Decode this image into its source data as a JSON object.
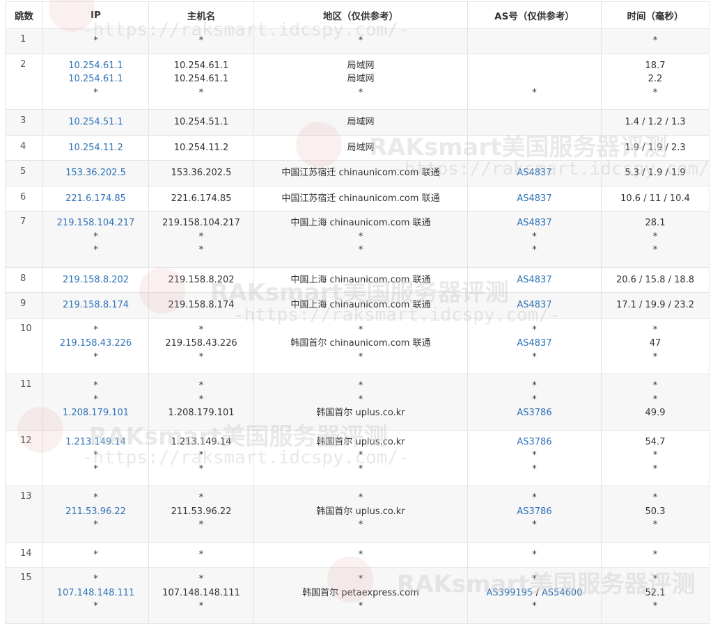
{
  "table": {
    "headers": [
      "跳数",
      "IP",
      "主机名",
      "地区（仅供参考）",
      "AS号（仅供参考）",
      "时间（毫秒）"
    ],
    "rows": [
      {
        "hop": "1",
        "lines": 1,
        "ip": [
          {
            "t": "*",
            "at": 0
          }
        ],
        "host": [
          {
            "t": "*",
            "at": 0
          }
        ],
        "region": [
          {
            "t": "*",
            "at": 0
          }
        ],
        "as": [
          [
            {
              "t": "*",
              "at": 0
            }
          ]
        ],
        "time": [
          {
            "t": "*",
            "at": 0
          }
        ]
      },
      {
        "hop": "2",
        "lines": 3,
        "ip": [
          {
            "t": "10.254.61.1",
            "at": 0,
            "link": true
          },
          {
            "t": "10.254.61.1",
            "at": 1,
            "link": true
          },
          {
            "t": "*",
            "at": 2
          }
        ],
        "host": [
          {
            "t": "10.254.61.1",
            "at": 0
          },
          {
            "t": "10.254.61.1",
            "at": 1
          },
          {
            "t": "*",
            "at": 2
          }
        ],
        "region": [
          {
            "t": "局域网",
            "at": 0
          },
          {
            "t": "局域网",
            "at": 1
          },
          {
            "t": "*",
            "at": 2
          }
        ],
        "as": [
          {
            "at": 2,
            "parts": [
              {
                "t": "*"
              }
            ]
          }
        ],
        "time": [
          {
            "t": "18.7",
            "at": 0
          },
          {
            "t": "2.2",
            "at": 1
          },
          {
            "t": "*",
            "at": 2
          }
        ]
      },
      {
        "hop": "3",
        "lines": 1,
        "ip": [
          {
            "t": "10.254.51.1",
            "at": 0,
            "link": true
          }
        ],
        "host": [
          {
            "t": "10.254.51.1",
            "at": 0
          }
        ],
        "region": [
          {
            "t": "局域网",
            "at": 0
          }
        ],
        "as": [],
        "time": [
          {
            "t": "1.4 / 1.2 / 1.3",
            "at": 0
          }
        ]
      },
      {
        "hop": "4",
        "lines": 1,
        "ip": [
          {
            "t": "10.254.11.2",
            "at": 0,
            "link": true
          }
        ],
        "host": [
          {
            "t": "10.254.11.2",
            "at": 0
          }
        ],
        "region": [
          {
            "t": "局域网",
            "at": 0
          }
        ],
        "as": [],
        "time": [
          {
            "t": "1.9 / 1.9 / 2.3",
            "at": 0
          }
        ]
      },
      {
        "hop": "5",
        "lines": 1,
        "ip": [
          {
            "t": "153.36.202.5",
            "at": 0,
            "link": true
          }
        ],
        "host": [
          {
            "t": "153.36.202.5",
            "at": 0
          }
        ],
        "region": [
          {
            "t": "中国江苏宿迁 chinaunicom.com 联通",
            "at": 0
          }
        ],
        "as": [
          {
            "at": 0,
            "parts": [
              {
                "t": "AS4837",
                "link": true
              }
            ]
          }
        ],
        "time": [
          {
            "t": "5.3 / 1.9 / 1.9",
            "at": 0
          }
        ]
      },
      {
        "hop": "6",
        "lines": 1,
        "ip": [
          {
            "t": "221.6.174.85",
            "at": 0,
            "link": true
          }
        ],
        "host": [
          {
            "t": "221.6.174.85",
            "at": 0
          }
        ],
        "region": [
          {
            "t": "中国江苏宿迁 chinaunicom.com 联通",
            "at": 0
          }
        ],
        "as": [
          {
            "at": 0,
            "parts": [
              {
                "t": "AS4837",
                "link": true
              }
            ]
          }
        ],
        "time": [
          {
            "t": "10.6 / 11 / 10.4",
            "at": 0
          }
        ]
      },
      {
        "hop": "7",
        "lines": 3,
        "ip": [
          {
            "t": "219.158.104.217",
            "at": 0,
            "link": true
          },
          {
            "t": "*",
            "at": 1
          },
          {
            "t": "*",
            "at": 2
          }
        ],
        "host": [
          {
            "t": "219.158.104.217",
            "at": 0
          },
          {
            "t": "*",
            "at": 1
          },
          {
            "t": "*",
            "at": 2
          }
        ],
        "region": [
          {
            "t": "中国上海 chinaunicom.com 联通",
            "at": 0
          },
          {
            "t": "*",
            "at": 1
          },
          {
            "t": "*",
            "at": 2
          }
        ],
        "as": [
          {
            "at": 0,
            "parts": [
              {
                "t": "AS4837",
                "link": true
              }
            ]
          },
          {
            "at": 1,
            "parts": [
              {
                "t": "*"
              }
            ]
          },
          {
            "at": 2,
            "parts": [
              {
                "t": "*"
              }
            ]
          }
        ],
        "time": [
          {
            "t": "28.1",
            "at": 0
          },
          {
            "t": "*",
            "at": 1
          },
          {
            "t": "*",
            "at": 2
          }
        ]
      },
      {
        "hop": "8",
        "lines": 1,
        "ip": [
          {
            "t": "219.158.8.202",
            "at": 0,
            "link": true
          }
        ],
        "host": [
          {
            "t": "219.158.8.202",
            "at": 0
          }
        ],
        "region": [
          {
            "t": "中国上海 chinaunicom.com 联通",
            "at": 0
          }
        ],
        "as": [
          {
            "at": 0,
            "parts": [
              {
                "t": "AS4837",
                "link": true
              }
            ]
          }
        ],
        "time": [
          {
            "t": "20.6 / 15.8 / 18.8",
            "at": 0
          }
        ]
      },
      {
        "hop": "9",
        "lines": 1,
        "ip": [
          {
            "t": "219.158.8.174",
            "at": 0,
            "link": true
          }
        ],
        "host": [
          {
            "t": "219.158.8.174",
            "at": 0
          }
        ],
        "region": [
          {
            "t": "中国上海 chinaunicom.com 联通",
            "at": 0
          }
        ],
        "as": [
          {
            "at": 0,
            "parts": [
              {
                "t": "AS4837",
                "link": true
              }
            ]
          }
        ],
        "time": [
          {
            "t": "17.1 / 19.9 / 23.2",
            "at": 0
          }
        ]
      },
      {
        "hop": "10",
        "lines": 3,
        "ip": [
          {
            "t": "*",
            "at": 0
          },
          {
            "t": "219.158.43.226",
            "at": 1,
            "link": true
          },
          {
            "t": "*",
            "at": 2
          }
        ],
        "host": [
          {
            "t": "*",
            "at": 0
          },
          {
            "t": "219.158.43.226",
            "at": 1
          },
          {
            "t": "*",
            "at": 2
          }
        ],
        "region": [
          {
            "t": "*",
            "at": 0
          },
          {
            "t": "韩国首尔 chinaunicom.com 联通",
            "at": 1
          },
          {
            "t": "*",
            "at": 2
          }
        ],
        "as": [
          {
            "at": 0,
            "parts": [
              {
                "t": "*"
              }
            ]
          },
          {
            "at": 1,
            "parts": [
              {
                "t": "AS4837",
                "link": true
              }
            ]
          },
          {
            "at": 2,
            "parts": [
              {
                "t": "*"
              }
            ]
          }
        ],
        "time": [
          {
            "t": "*",
            "at": 0
          },
          {
            "t": "47",
            "at": 1
          },
          {
            "t": "*",
            "at": 2
          }
        ]
      },
      {
        "hop": "11",
        "lines": 3,
        "ip": [
          {
            "t": "*",
            "at": 0
          },
          {
            "t": "*",
            "at": 1
          },
          {
            "t": "1.208.179.101",
            "at": 2,
            "link": true
          }
        ],
        "host": [
          {
            "t": "*",
            "at": 0
          },
          {
            "t": "*",
            "at": 1
          },
          {
            "t": "1.208.179.101",
            "at": 2
          }
        ],
        "region": [
          {
            "t": "*",
            "at": 0
          },
          {
            "t": "*",
            "at": 1
          },
          {
            "t": "韩国首尔 uplus.co.kr",
            "at": 2
          }
        ],
        "as": [
          {
            "at": 0,
            "parts": [
              {
                "t": "*"
              }
            ]
          },
          {
            "at": 1,
            "parts": [
              {
                "t": "*"
              }
            ]
          },
          {
            "at": 2,
            "parts": [
              {
                "t": "AS3786",
                "link": true
              }
            ]
          }
        ],
        "time": [
          {
            "t": "*",
            "at": 0
          },
          {
            "t": "*",
            "at": 1
          },
          {
            "t": "49.9",
            "at": 2
          }
        ]
      },
      {
        "hop": "12",
        "lines": 3,
        "ip": [
          {
            "t": "1.213.149.14",
            "at": 0,
            "link": true
          },
          {
            "t": "*",
            "at": 1
          },
          {
            "t": "*",
            "at": 2
          }
        ],
        "host": [
          {
            "t": "1.213.149.14",
            "at": 0
          },
          {
            "t": "*",
            "at": 1
          },
          {
            "t": "*",
            "at": 2
          }
        ],
        "region": [
          {
            "t": "韩国首尔 uplus.co.kr",
            "at": 0
          },
          {
            "t": "*",
            "at": 1
          },
          {
            "t": "*",
            "at": 2
          }
        ],
        "as": [
          {
            "at": 0,
            "parts": [
              {
                "t": "AS3786",
                "link": true
              }
            ]
          },
          {
            "at": 1,
            "parts": [
              {
                "t": "*"
              }
            ]
          },
          {
            "at": 2,
            "parts": [
              {
                "t": "*"
              }
            ]
          }
        ],
        "time": [
          {
            "t": "54.7",
            "at": 0
          },
          {
            "t": "*",
            "at": 1
          },
          {
            "t": "*",
            "at": 2
          }
        ]
      },
      {
        "hop": "13",
        "lines": 3,
        "ip": [
          {
            "t": "*",
            "at": 0
          },
          {
            "t": "211.53.96.22",
            "at": 1,
            "link": true
          },
          {
            "t": "*",
            "at": 2
          }
        ],
        "host": [
          {
            "t": "*",
            "at": 0
          },
          {
            "t": "211.53.96.22",
            "at": 1
          },
          {
            "t": "*",
            "at": 2
          }
        ],
        "region": [
          {
            "t": "*",
            "at": 0
          },
          {
            "t": "韩国首尔 uplus.co.kr",
            "at": 1
          },
          {
            "t": "*",
            "at": 2
          }
        ],
        "as": [
          {
            "at": 0,
            "parts": [
              {
                "t": "*"
              }
            ]
          },
          {
            "at": 1,
            "parts": [
              {
                "t": "AS3786",
                "link": true
              }
            ]
          },
          {
            "at": 2,
            "parts": [
              {
                "t": "*"
              }
            ]
          }
        ],
        "time": [
          {
            "t": "*",
            "at": 0
          },
          {
            "t": "50.3",
            "at": 1
          },
          {
            "t": "*",
            "at": 2
          }
        ]
      },
      {
        "hop": "14",
        "lines": 1,
        "ip": [
          {
            "t": "*",
            "at": 0
          }
        ],
        "host": [
          {
            "t": "*",
            "at": 0
          }
        ],
        "region": [
          {
            "t": "*",
            "at": 0
          }
        ],
        "as": [
          {
            "at": 0,
            "parts": [
              {
                "t": "*"
              }
            ]
          }
        ],
        "time": [
          {
            "t": "*",
            "at": 0
          }
        ]
      },
      {
        "hop": "15",
        "lines": 3,
        "ip": [
          {
            "t": "*",
            "at": 0
          },
          {
            "t": "107.148.148.111",
            "at": 1,
            "link": true
          },
          {
            "t": "*",
            "at": 2
          }
        ],
        "host": [
          {
            "t": "*",
            "at": 0
          },
          {
            "t": "107.148.148.111",
            "at": 1
          },
          {
            "t": "*",
            "at": 2
          }
        ],
        "region": [
          {
            "t": "*",
            "at": 0
          },
          {
            "t": "韩国首尔 petaexpress.com",
            "at": 1
          },
          {
            "t": "*",
            "at": 2
          }
        ],
        "as": [
          {
            "at": 0,
            "parts": [
              {
                "t": "*"
              }
            ]
          },
          {
            "at": 1,
            "parts": [
              {
                "t": "AS399195",
                "link": true
              },
              {
                "t": " / "
              },
              {
                "t": "AS54600",
                "link": true
              }
            ]
          },
          {
            "at": 2,
            "parts": [
              {
                "t": "*"
              }
            ]
          }
        ],
        "time": [
          {
            "t": "*",
            "at": 0
          },
          {
            "t": "52.1",
            "at": 1
          },
          {
            "t": "*",
            "at": 2
          }
        ]
      }
    ]
  },
  "watermark": {
    "brand": "RAKsmart美国服务器评测",
    "url": "-https://raksmart.idcspy.com/-"
  },
  "colors": {
    "link": "#2e72b8",
    "border": "#e4e4e4",
    "alt_row": "#f7f7f7"
  }
}
